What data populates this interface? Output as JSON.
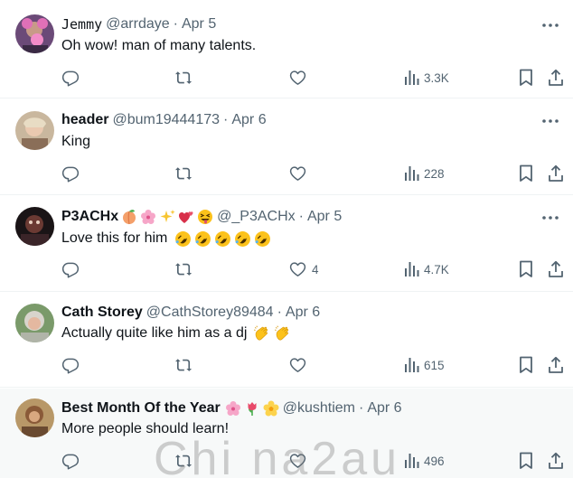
{
  "tweets": [
    {
      "name": "Jemmy",
      "handle": "@arrdaye",
      "separator": "·",
      "date": "Apr 5",
      "text": "Oh wow! man of many talents.",
      "replies": "",
      "retweets": "",
      "likes": "",
      "views": "3.3K",
      "emoji_name": [],
      "emoji_text": []
    },
    {
      "name": "header",
      "handle": "@bum19444173",
      "separator": "·",
      "date": "Apr 6",
      "text": "King",
      "replies": "",
      "retweets": "",
      "likes": "",
      "views": "228",
      "emoji_name": [],
      "emoji_text": []
    },
    {
      "name": "P3ACHx",
      "handle": "@_P3ACHx",
      "separator": "·",
      "date": "Apr 5",
      "text": "Love this for him",
      "replies": "",
      "retweets": "",
      "likes": "4",
      "views": "4.7K",
      "emoji_name": [
        "peach",
        "cherry-blossom",
        "sparkles",
        "two-hearts",
        "squinting-tongue-face"
      ],
      "emoji_text": [
        "rofl",
        "rofl",
        "rofl",
        "rofl",
        "rofl"
      ]
    },
    {
      "name": "Cath Storey",
      "handle": "@CathStorey89484",
      "separator": "·",
      "date": "Apr 6",
      "text": "Actually quite like him as a dj",
      "replies": "",
      "retweets": "",
      "likes": "",
      "views": "615",
      "emoji_name": [],
      "emoji_text": [
        "clapping-hands",
        "clapping-hands"
      ]
    },
    {
      "name": "Best Month Of the Year",
      "handle": "@kushtiem",
      "separator": "·",
      "date": "Apr 6",
      "text": "More people should learn!",
      "replies": "",
      "retweets": "",
      "likes": "",
      "views": "496",
      "emoji_name": [
        "cherry-blossom",
        "tulip",
        "blossom"
      ],
      "emoji_text": []
    }
  ],
  "watermark": "Chi na2au",
  "icons": [
    "reply-icon",
    "retweet-icon",
    "like-icon",
    "views-icon",
    "bookmark-icon",
    "share-icon",
    "more-icon"
  ],
  "colors": {
    "text": "#0f1419",
    "secondary": "#536471",
    "divider": "#eff3f4"
  }
}
